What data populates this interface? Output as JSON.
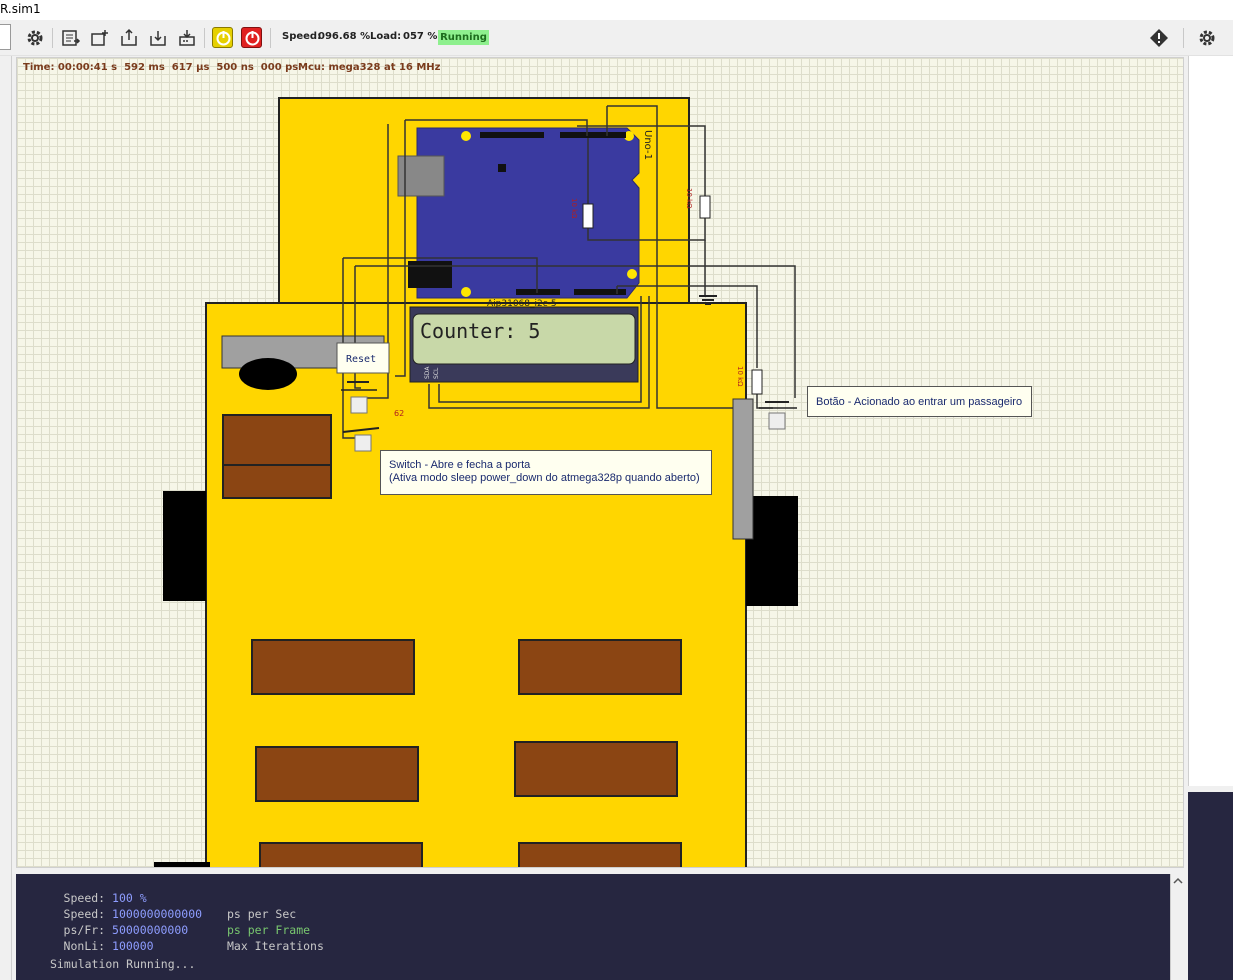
{
  "window": {
    "title": "R.sim1"
  },
  "toolbar": {
    "speed_label": "Speed:",
    "speed_value": "096.68 %",
    "load_label": "Load:",
    "load_value": "057 %",
    "state": "Running",
    "icons": [
      "settings-icon",
      "export-list-icon",
      "add-component-icon",
      "open-icon",
      "save-icon",
      "burn-icon",
      "power-pause-icon",
      "power-stop-icon",
      "info-icon",
      "settings-icon"
    ]
  },
  "circuit": {
    "time": "Time: 00:00:41 s  592 ms  617 µs  500 ns  000 ps",
    "mcu": "Mcu: mega328 at 16 MHz",
    "board_label": "Uno-1",
    "lcd_label": "Aip31068_i2c-5",
    "lcd_text": "Counter: 5",
    "lcd_pin_sda": "SDA",
    "lcd_pin_scl": "SCL",
    "reset_label": "Reset",
    "r1_label": "10 kΩ",
    "r2_label": "10 kΩ",
    "r3_label": "10 kΩ",
    "wire_62": "62",
    "note_button": "Botão - Acionado ao entrar um passageiro",
    "note_switch_line1": "Switch - Abre e fecha a porta",
    "note_switch_line2": "(Ativa modo sleep power_down do atmega328p quando aberto)",
    "colors": {
      "bus_yellow": "#ffd600",
      "seat_brown": "#8b4513",
      "board_blue": "#3a3aa0",
      "lcd_green": "#c8d8a8"
    }
  },
  "console": {
    "lines": [
      {
        "label": "Speed:",
        "value": "100 %",
        "desc": ""
      },
      {
        "label": "Speed:",
        "value": "1000000000000",
        "desc": "ps per Sec"
      },
      {
        "label": "ps/Fr:",
        "value": "50000000000",
        "desc": "ps per Frame"
      },
      {
        "label": "NonLi:",
        "value": "100000",
        "desc": "Max Iterations"
      }
    ],
    "status": "Simulation Running..."
  }
}
